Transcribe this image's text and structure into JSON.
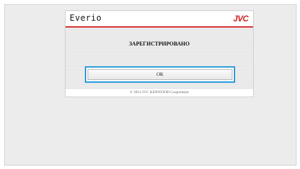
{
  "header": {
    "app_title": "Everio",
    "brand_logo": "JVC"
  },
  "dialog": {
    "status_text": "ЗАРЕГИСТРИРОВАНО",
    "ok_label": "OK"
  },
  "footer": {
    "copyright": "© 2012 JVC KENWOOD Corporation"
  },
  "colors": {
    "brand_red": "#d21f1f",
    "focus_blue": "#2a9ad8"
  }
}
